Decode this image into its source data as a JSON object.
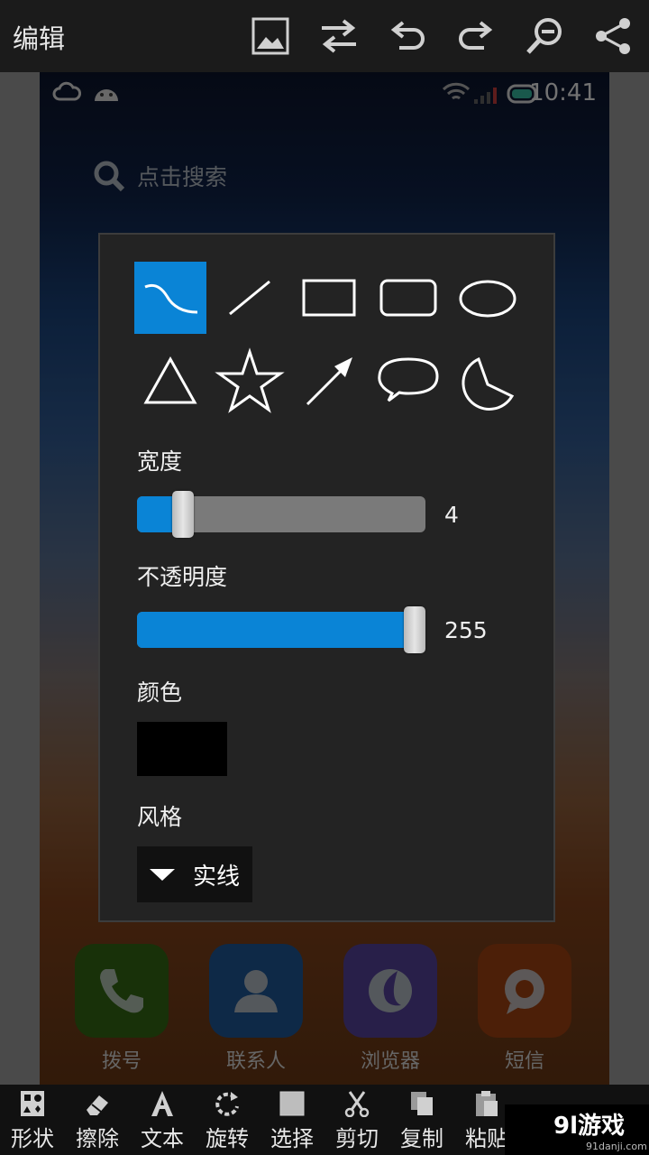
{
  "top_bar": {
    "title": "编辑",
    "actions": [
      {
        "icon": "image-icon"
      },
      {
        "icon": "swap-icon"
      },
      {
        "icon": "undo-icon"
      },
      {
        "icon": "redo-icon"
      },
      {
        "icon": "zoom-out-icon"
      },
      {
        "icon": "share-icon"
      }
    ]
  },
  "background_screen": {
    "status_bar": {
      "time": "10:41"
    },
    "search_placeholder": "点击搜索",
    "dock": [
      {
        "label": "拨号",
        "icon": "phone-icon",
        "color": "#2c5a12"
      },
      {
        "label": "联系人",
        "icon": "contact-icon",
        "color": "#1a4b82"
      },
      {
        "label": "浏览器",
        "icon": "browser-icon",
        "color": "#4a3a86"
      },
      {
        "label": "短信",
        "icon": "message-icon",
        "color": "#8a3a10"
      }
    ]
  },
  "shape_dialog": {
    "shapes": [
      {
        "name": "freehand",
        "selected": true
      },
      {
        "name": "line",
        "selected": false
      },
      {
        "name": "rectangle",
        "selected": false
      },
      {
        "name": "rounded-rectangle",
        "selected": false
      },
      {
        "name": "ellipse",
        "selected": false
      },
      {
        "name": "triangle",
        "selected": false
      },
      {
        "name": "star",
        "selected": false
      },
      {
        "name": "arrow",
        "selected": false
      },
      {
        "name": "speech-bubble",
        "selected": false
      },
      {
        "name": "pie",
        "selected": false
      }
    ],
    "width": {
      "label": "宽度",
      "value": "4",
      "fraction": 0.16
    },
    "opacity": {
      "label": "不透明度",
      "value": "255",
      "fraction": 1.0
    },
    "color": {
      "label": "颜色",
      "value": "#000000"
    },
    "style": {
      "label": "风格",
      "selected": "实线"
    }
  },
  "bottom_bar": {
    "tools": [
      {
        "label": "形状",
        "icon": "shapes-icon"
      },
      {
        "label": "擦除",
        "icon": "eraser-icon"
      },
      {
        "label": "文本",
        "icon": "text-icon"
      },
      {
        "label": "旋转",
        "icon": "rotate-icon"
      },
      {
        "label": "选择",
        "icon": "select-icon"
      },
      {
        "label": "剪切",
        "icon": "scissors-icon"
      },
      {
        "label": "复制",
        "icon": "copy-icon"
      },
      {
        "label": "粘贴",
        "icon": "paste-icon"
      }
    ]
  },
  "accent_color": "#0a84d6"
}
